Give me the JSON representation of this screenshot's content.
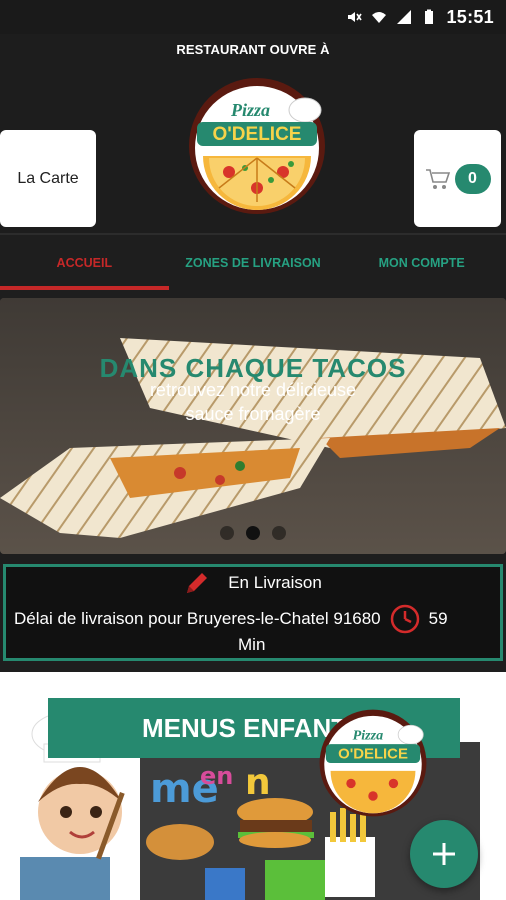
{
  "status_bar": {
    "time": "15:51"
  },
  "header": {
    "open_text": "RESTAURANT OUVRE À",
    "carte_label": "La Carte",
    "cart_count": "0",
    "logo": {
      "line1": "Pizza",
      "line2": "O'DELICE"
    }
  },
  "tabs": [
    {
      "label": "ACCUEIL",
      "active": true
    },
    {
      "label": "ZONES DE LIVRAISON",
      "active": false
    },
    {
      "label": "MON COMPTE",
      "active": false
    }
  ],
  "banner": {
    "title": "DANS CHAQUE TACOS",
    "subtitle_line1": "retrouvez notre délicieuse",
    "subtitle_line2": "sauce fromagère",
    "slide_count": 3,
    "active_slide": 2
  },
  "delivery": {
    "mode": "En Livraison",
    "delay_text": "Délai de livraison pour Bruyeres-le-Chatel 91680",
    "delay_value": "59",
    "delay_unit": "Min"
  },
  "menus": {
    "title": "MENUS ENFANTS",
    "logo": {
      "line1": "Pizza",
      "line2": "O'DELICE"
    }
  },
  "colors": {
    "accent": "#26896f",
    "active_tab": "#c62828",
    "background": "#1e1e1e"
  }
}
